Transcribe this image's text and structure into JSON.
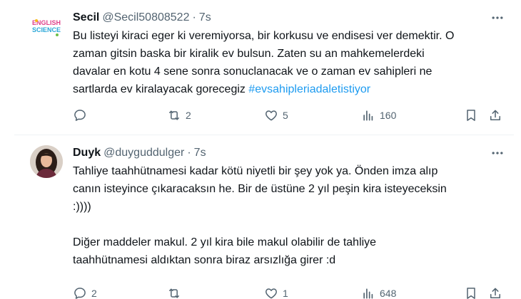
{
  "tweets": [
    {
      "name": "Secil",
      "handle": "@Secil50808522",
      "separator": "·",
      "time": "7s",
      "avatar_icon": "english-science-logo-icon",
      "avatar_text_top": "ENGLISH",
      "avatar_text_bottom": "SCIENCE",
      "text": "Bu listeyi kiraci eger ki veremiyorsa, bir korkusu ve endisesi ver demektir. O\nzaman gitsin baska bir kiralik ev bulsun. Zaten su an mahkemelerdeki\ndavalar en kotu 4 sene sonra sonuclanacak ve o zaman ev sahipleri ne\nsartlarda ev kiralayacak gorecegiz ",
      "hashtag": "#evsahipleriadaletistiyor",
      "replies": "",
      "retweets": "2",
      "likes": "5",
      "views": "160"
    },
    {
      "name": "Duyk",
      "handle": "@duyguddulger",
      "separator": "·",
      "time": "7s",
      "avatar_icon": "profile-photo-icon",
      "text": "Tahliye taahhütnamesi kadar kötü niyetli bir şey yok ya. Önden imza alıp\ncanın isteyince çıkaracaksın he. Bir de üstüne 2 yıl peşin kira isteyeceksin\n:))))\n\nDiğer maddeler makul. 2 yıl kira bile makul olabilir de tahliye\ntaahhütnamesi aldıktan sonra biraz arsızlığa girer :d",
      "replies": "2",
      "retweets": "",
      "likes": "1",
      "views": "648"
    }
  ],
  "colors": {
    "text": "#0f1419",
    "secondary": "#536471",
    "link": "#1d9bf0",
    "divider": "#eff3f4"
  }
}
